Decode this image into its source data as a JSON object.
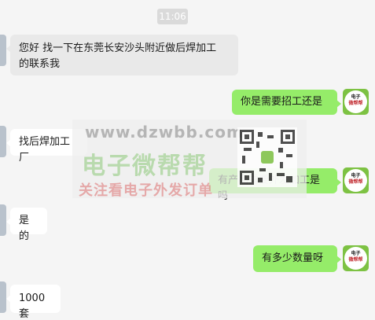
{
  "chat": {
    "timestamp": "11:06",
    "messages": [
      {
        "side": "left",
        "text_line1": "您好 找一下在东莞长安沙头附近做后焊加工",
        "text_line2": "的联系我"
      },
      {
        "side": "right",
        "text": "你是需要招工还是"
      },
      {
        "side": "left",
        "text": "找后焊加工厂"
      },
      {
        "side": "right",
        "text": "有产品需要外发加工是吗"
      },
      {
        "side": "left",
        "text": "是的"
      },
      {
        "side": "right",
        "text": "有多少数量呀"
      },
      {
        "side": "left",
        "text": "1000套"
      }
    ],
    "self_avatar": {
      "line1": "电子",
      "line2": "微帮帮"
    }
  },
  "watermark": {
    "url": "www.dzwbb.com",
    "title": "电子微帮帮",
    "subtitle": "关注看电子外发订单"
  },
  "colors": {
    "background": "#f5f5f5",
    "own_bubble": "#95ec69",
    "other_bubble": "#ffffff",
    "avatar_green": "#7dc243"
  }
}
